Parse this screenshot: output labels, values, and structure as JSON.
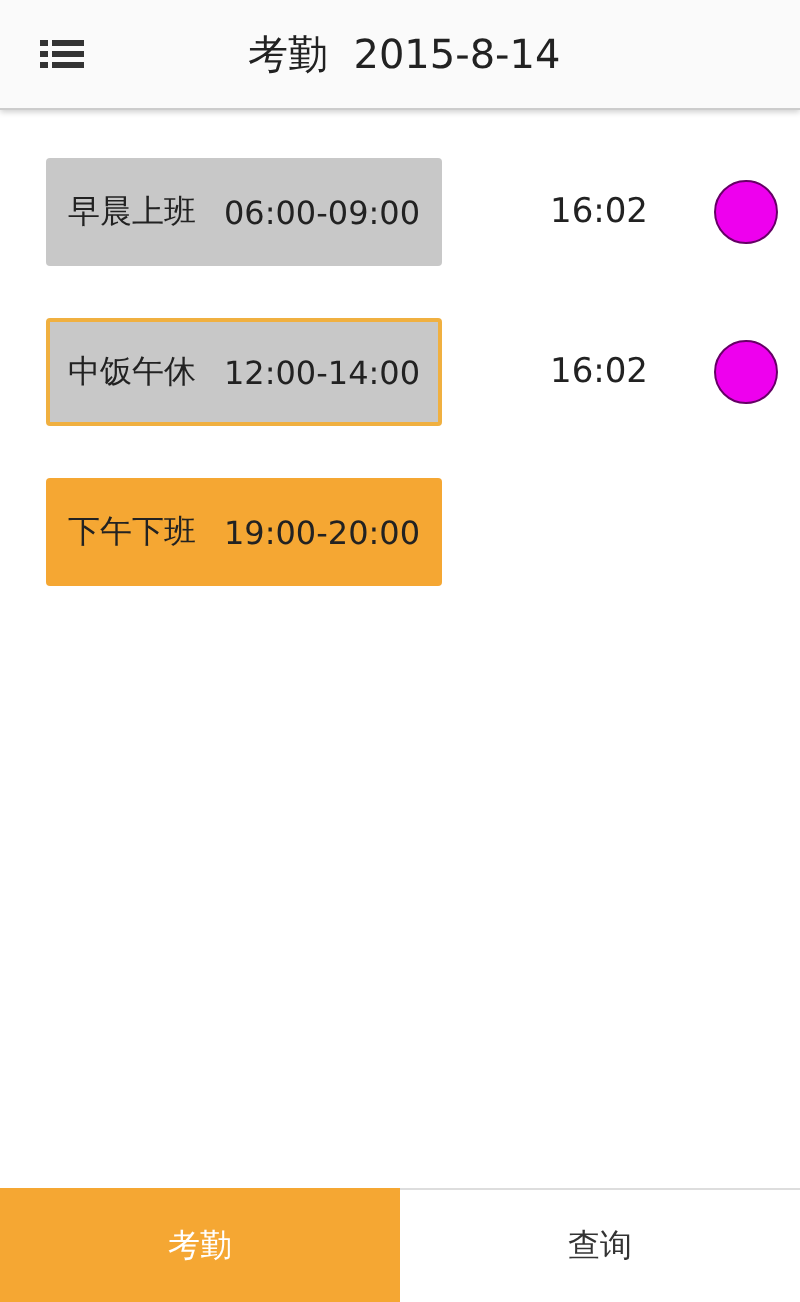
{
  "header": {
    "title": "考勤  2015-8-14"
  },
  "shifts": [
    {
      "name": "早晨上班",
      "hours": "06:00-09:00",
      "done": true,
      "selected": false,
      "time": "16:02",
      "color": "#ee00ee"
    },
    {
      "name": "中饭午休",
      "hours": "12:00-14:00",
      "done": true,
      "selected": true,
      "time": "16:02",
      "color": "#ee00ee"
    },
    {
      "name": "下午下班",
      "hours": "19:00-20:00",
      "done": false,
      "selected": false
    }
  ],
  "tabs": [
    {
      "label": "考勤",
      "selected": true
    },
    {
      "label": "查询",
      "selected": false
    }
  ]
}
